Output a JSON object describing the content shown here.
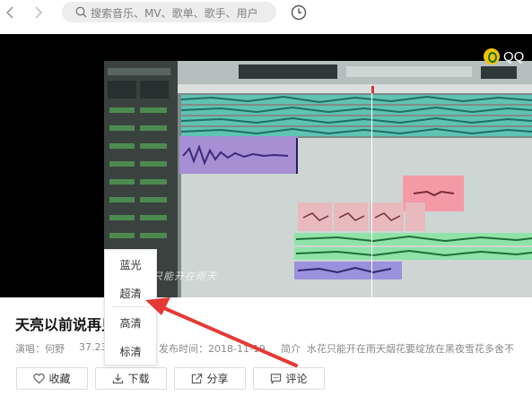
{
  "nav": {
    "back_icon": "chevron-left-icon",
    "forward_icon": "chevron-right-icon",
    "search_placeholder": "搜索音乐、MV、歌单、歌手、用户",
    "history_icon": "clock-icon"
  },
  "player": {
    "brand_text": "QQ",
    "watermark_text": "水花只能开在雨天"
  },
  "song": {
    "title": "天亮以前说再见",
    "singer_label": "演唱：何野",
    "play_count": "37.23",
    "release_label": "发布时间：2018-11-19",
    "intro_label": "简介",
    "intro_text": "水花只能开在雨天烟花要绽放在黑夜雪花多舍不"
  },
  "actions": {
    "collect": "收藏",
    "download": "下载",
    "share": "分享",
    "comment": "评论"
  },
  "quality_menu": {
    "options": [
      "蓝光",
      "超清",
      "高清",
      "标清"
    ]
  },
  "colors": {
    "annotation_arrow": "#e53935",
    "search_bg": "#ededed",
    "button_border": "#dcdcdc"
  }
}
